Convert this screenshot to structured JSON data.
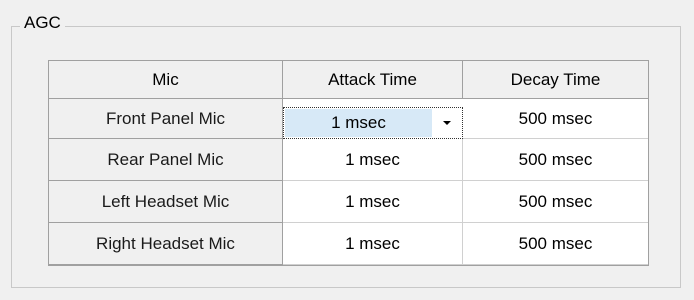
{
  "group": {
    "title": "AGC"
  },
  "table": {
    "columns": [
      "Mic",
      "Attack Time",
      "Decay Time"
    ],
    "rows": [
      {
        "mic": "Front Panel Mic",
        "attack": "1 msec",
        "decay": "500 msec"
      },
      {
        "mic": "Rear Panel Mic",
        "attack": "1 msec",
        "decay": "500 msec"
      },
      {
        "mic": "Left Headset Mic",
        "attack": "1 msec",
        "decay": "500 msec"
      },
      {
        "mic": "Right Headset Mic",
        "attack": "1 msec",
        "decay": "500 msec"
      }
    ],
    "selected_row": 0,
    "selected_column": "attack"
  },
  "colors": {
    "selection": "#d7e9f7",
    "header_bg": "#f0f0f0",
    "grid_border": "#a0a0a0"
  }
}
